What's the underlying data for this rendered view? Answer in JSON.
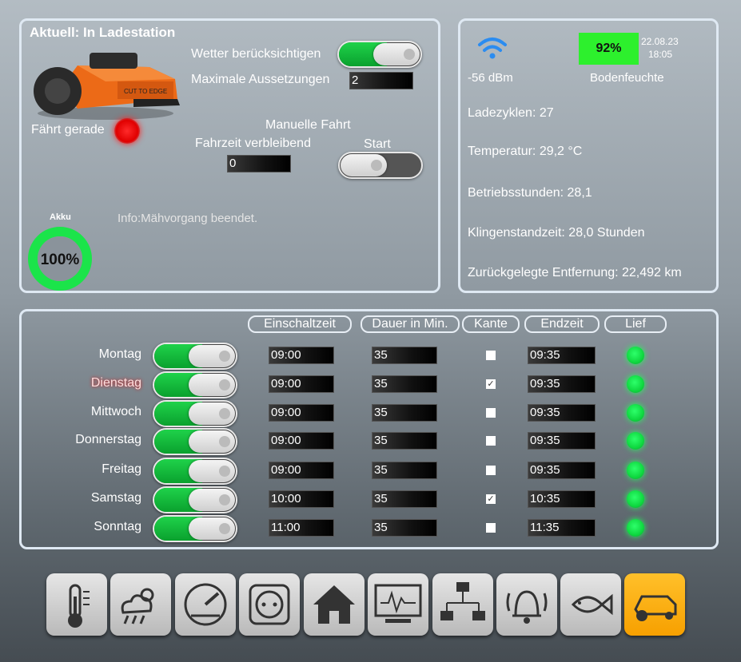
{
  "status": {
    "title": "Aktuell: In Ladestation",
    "weather_label": "Wetter berücksichtigen",
    "max_pause_label": "Maximale Aussetzungen",
    "max_pause_value": "2",
    "driving_label": "Fährt gerade",
    "manual_label": "Manuelle Fahrt",
    "remaining_label": "Fahrzeit verbleibend",
    "remaining_value": "0",
    "start_label": "Start",
    "akku_label": "Akku",
    "akku_value": "100%",
    "akku_percent": 100,
    "info": "Info:Mähvorgang beendet.",
    "mower_brand": "CUT TO EDGE"
  },
  "stats": {
    "wifi": "-56 dBm",
    "moisture_value": "92%",
    "moisture_label": "Bodenfeuchte",
    "date": "22.08.23",
    "time": "18:05",
    "charge_cycles": "Ladezyklen: 27",
    "temperature": "Temperatur: 29,2 °C",
    "operating_hours": "Betriebsstunden: 28,1",
    "blade_time": "Klingenstandzeit: 28,0 Stunden",
    "distance": "Zurückgelegte Entfernung: 22,492 km"
  },
  "schedule": {
    "headers": {
      "start": "Einschaltzeit",
      "duration": "Dauer in Min.",
      "edge": "Kante",
      "end": "Endzeit",
      "ran": "Lief"
    },
    "days": [
      {
        "name": "Montag",
        "start": "09:00",
        "duration": "35",
        "edge": false,
        "end": "09:35"
      },
      {
        "name": "Dienstag",
        "start": "09:00",
        "duration": "35",
        "edge": true,
        "end": "09:35"
      },
      {
        "name": "Mittwoch",
        "start": "09:00",
        "duration": "35",
        "edge": false,
        "end": "09:35"
      },
      {
        "name": "Donnerstag",
        "start": "09:00",
        "duration": "35",
        "edge": false,
        "end": "09:35"
      },
      {
        "name": "Freitag",
        "start": "09:00",
        "duration": "35",
        "edge": false,
        "end": "09:35"
      },
      {
        "name": "Samstag",
        "start": "10:00",
        "duration": "35",
        "edge": true,
        "end": "10:35"
      },
      {
        "name": "Sonntag",
        "start": "11:00",
        "duration": "35",
        "edge": false,
        "end": "11:35"
      }
    ]
  },
  "nav": [
    "thermometer-icon",
    "weather-icon",
    "gauge-icon",
    "power-socket-icon",
    "home-icon",
    "monitor-icon",
    "network-icon",
    "alarm-bell-icon",
    "fish-icon",
    "lawn-mower-icon"
  ],
  "colors": {
    "led_green": "#1eff5a",
    "led_red": "#ff1a1a",
    "moisture_bg": "#2df02d",
    "active_nav": "#f7a000"
  }
}
